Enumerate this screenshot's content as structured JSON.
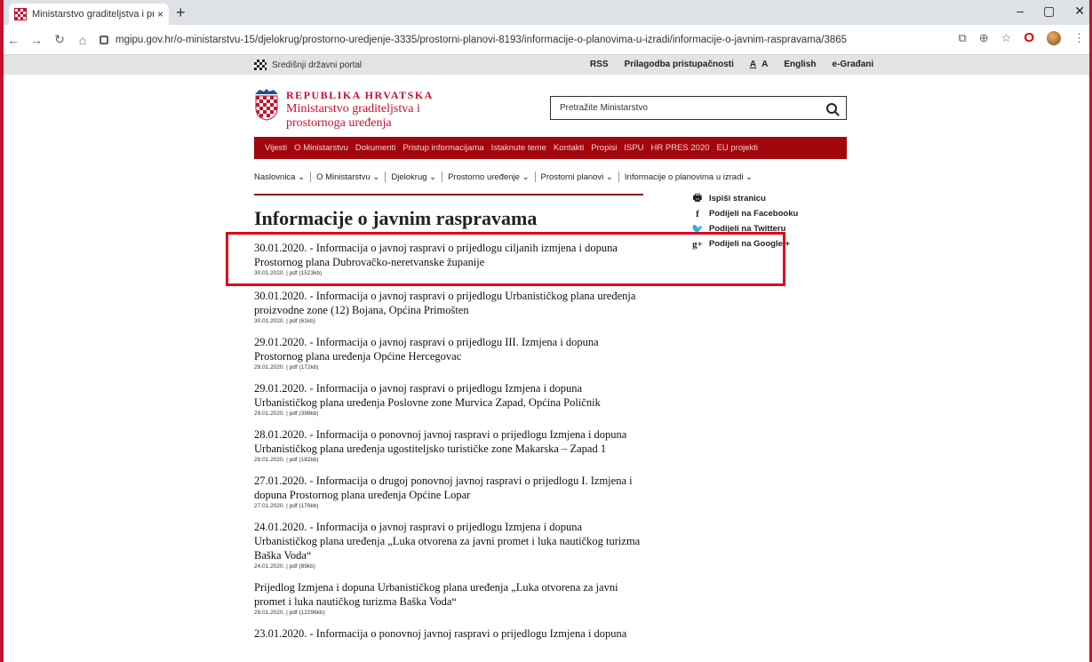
{
  "browser": {
    "tab_title": "Ministarstvo graditeljstva i prosto",
    "tab_close": "×",
    "new_tab": "+",
    "url": "mgipu.gov.hr/o-ministarstvu-15/djelokrug/prostorno-uredjenje-3335/prostorni-planovi-8193/informacije-o-planovima-u-izradi/informacije-o-javnim-raspravama/3865",
    "win_min": "–",
    "win_max": "▢",
    "win_close": "✕"
  },
  "gov_strip": {
    "portal": "Središnji državni portal",
    "links": [
      "RSS",
      "Prilagodba pristupačnosti",
      "A",
      "A",
      "English",
      "e-Građani"
    ]
  },
  "header": {
    "line1": "REPUBLIKA HRVATSKA",
    "line2": "Ministarstvo graditeljstva i",
    "line3": "prostornoga uređenja",
    "search_placeholder": "Pretražite Ministarstvo"
  },
  "menu": [
    "Vijesti",
    "O Ministarstvu",
    "Dokumenti",
    "Pristup informacijama",
    "Istaknute teme",
    "Kontakti",
    "Propisi",
    "ISPU",
    "HR PRES 2020",
    "EU projekti"
  ],
  "breadcrumbs": [
    "Naslovnica ⌄",
    "O Ministarstvu ⌄",
    "Djelokrug ⌄",
    "Prostorno uređenje ⌄",
    "Prostorni planovi ⌄",
    "Informacije o planovima u izradi ⌄"
  ],
  "share": [
    {
      "icon": "🖶",
      "label": "Ispiši stranicu"
    },
    {
      "icon": "f",
      "label": "Podijeli na Facebooku"
    },
    {
      "icon": "🐦",
      "label": "Podijeli na Twitteru"
    },
    {
      "icon": "g+",
      "label": "Podijeli na Google +"
    }
  ],
  "page_title": "Informacije o javnim raspravama",
  "items": [
    {
      "title": "30.01.2020. - Informacija o javnoj raspravi o prijedlogu ciljanih izmjena i dopuna Prostornog plana Dubrovačko-neretvanske županije",
      "meta": "30.01.2020. | pdf (1523kb)"
    },
    {
      "title": "30.01.2020. - Informacija o javnoj raspravi o prijedlogu Urbanističkog plana uređenja proizvodne zone (12) Bojana, Općina Primošten",
      "meta": "30.01.2020. | pdf (61kb)"
    },
    {
      "title": "29.01.2020. - Informacija o javnoj raspravi o prijedlogu III. Izmjena i dopuna Prostornog plana uređenja Općine Hercegovac",
      "meta": "29.01.2020. | pdf (172kb)"
    },
    {
      "title": "29.01.2020. - Informacija o javnoj raspravi o prijedlogu Izmjena i dopuna Urbanističkog plana uređenja Poslovne zone Murvica Zapad, Općina Poličnik",
      "meta": "29.01.2020. | pdf (398kb)"
    },
    {
      "title": "28.01.2020. - Informacija o ponovnoj javnoj raspravi o prijedlogu Izmjena i dopuna Urbanističkog plana uređenja ugostiteljsko turističke zone Makarska – Zapad 1",
      "meta": "28.01.2020. | pdf (182kb)"
    },
    {
      "title": "27.01.2020. - Informacija o drugoj ponovnoj javnoj raspravi o prijedlogu I. Izmjena i dopuna Prostornog plana uređenja Općine Lopar",
      "meta": "27.01.2020. | pdf (178kb)"
    },
    {
      "title": "24.01.2020. - Informacija o javnoj raspravi o prijedlogu Izmjena i dopuna Urbanističkog plana uređenja „Luka otvorena za javni promet i luka nautičkog turizma Baška Voda“",
      "meta": "24.01.2020. | pdf (89kb)"
    },
    {
      "title": "Prijedlog Izmjena i dopuna Urbanističkog plana uređenja „Luka otvorena za javni promet i luka nautičkog turizma Baška Voda“",
      "meta": "28.01.2020. | pdf (12296kb)"
    },
    {
      "title": "23.01.2020. - Informacija o ponovnoj javnoj raspravi o prijedlogu Izmjena i dopuna",
      "meta": ""
    }
  ]
}
